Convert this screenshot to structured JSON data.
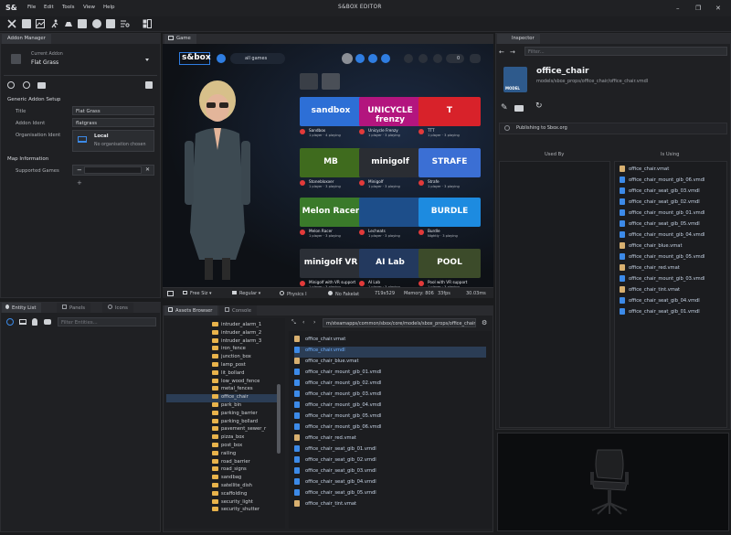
{
  "app": {
    "logo": "S&",
    "title": "S&BOX EDITOR"
  },
  "menu": [
    "File",
    "Edit",
    "Tools",
    "View",
    "Help"
  ],
  "window_controls": {
    "minimize": "–",
    "maximize": "❐",
    "close": "✕"
  },
  "addon_manager": {
    "tab": "Addon Manager",
    "current_label": "Current Addon",
    "current_value": "Flat Grass",
    "setup_title": "Generic Addon Setup",
    "fields": [
      {
        "label": "Title",
        "value": "Flat Grass"
      },
      {
        "label": "Addon Ident",
        "value": "flatgrass"
      }
    ],
    "org_label": "Organisation Ident",
    "org_name": "Local",
    "org_sub": "No organisation chosen",
    "map_info_title": "Map Information",
    "supported_games_label": "Supported Games",
    "add_symbol": "+",
    "remove_symbol": "✕",
    "minus_symbol": "−"
  },
  "game": {
    "tab": "Game",
    "brand": "s&box",
    "all_games": "all games",
    "badge": "0",
    "tiles": [
      {
        "label": "sandbox",
        "title": "Sandbox",
        "meta": "1 player · 4 playing",
        "bg": "#2d6fd6"
      },
      {
        "label": "UNICYCLE frenzy",
        "title": "Unicycle Frenzy",
        "meta": "1 player · 3 playing",
        "bg": "#b3157e"
      },
      {
        "label": "T",
        "title": "TTT",
        "meta": "1 player · 3 playing",
        "bg": "#d8222a"
      },
      {
        "label": "MB",
        "title": "Stonebloxxer",
        "meta": "1 player · 3 playing",
        "bg": "#3f6b1e"
      },
      {
        "label": "minigolf",
        "title": "Minigolf",
        "meta": "1 player · 3 playing",
        "bg": "#2a2d33"
      },
      {
        "label": "STRAFE",
        "title": "Strafe",
        "meta": "1 player · 3 playing",
        "bg": "#3b6fd4"
      },
      {
        "label": "Melon Racer",
        "title": "Melon Racer",
        "meta": "1 player · 3 playing",
        "bg": "#3a7a2a"
      },
      {
        "label": "",
        "title": "Lecheats",
        "meta": "1 player · 3 playing",
        "bg": "#1d4e8a"
      },
      {
        "label": "BURDLE",
        "title": "Burdle",
        "meta": "Nightly · 3 playing",
        "bg": "#1d8be0"
      },
      {
        "label": "minigolf VR",
        "title": "Minigolf with VR support",
        "meta": "1 player · 3 playing",
        "bg": "#2b2f36"
      },
      {
        "label": "AI Lab",
        "title": "AI Lab",
        "meta": "1 player · 3 playing",
        "bg": "#23395e"
      },
      {
        "label": "POOL",
        "title": "Pool with VR support",
        "meta": "1 player · 3 playing",
        "bg": "#3c4b2a"
      }
    ]
  },
  "game_status": {
    "free_size": "Free Siz",
    "regular": "Regular",
    "physics": "Physics I",
    "no_fake_lag": "No Fakelat",
    "resolution": "719x529",
    "memory": "Memory: 806",
    "fps": "33fps",
    "ms": "30.03ms"
  },
  "inspector": {
    "tab": "Inspector",
    "filter_placeholder": "Filter...",
    "asset_name": "office_chair",
    "asset_path": "models/sbox_props/office_chair/office_chair.vmdl",
    "model_badge": "MODEL",
    "publish": "Publishing to Sbox.org",
    "used_by": "Used By",
    "is_using": "Is Using",
    "is_using_items": [
      "office_chair.vmat",
      "office_chair_mount_gib_06.vmdl",
      "office_chair_seat_gib_03.vmdl",
      "office_chair_seat_gib_02.vmdl",
      "office_chair_mount_gib_01.vmdl",
      "office_chair_seat_gib_05.vmdl",
      "office_chair_mount_gib_04.vmdl",
      "office_chair_blue.vmat",
      "office_chair_mount_gib_05.vmdl",
      "office_chair_red.vmat",
      "office_chair_mount_gib_03.vmdl",
      "office_chair_tint.vmat",
      "office_chair_seat_gib_04.vmdl",
      "office_chair_seat_gib_01.vmdl"
    ]
  },
  "entity_list": {
    "tabs": [
      "Entity List",
      "Panels",
      "Icons"
    ],
    "filter_placeholder": "Filter Entities..."
  },
  "assets": {
    "tabs": [
      "Assets Browser",
      "Console"
    ],
    "path": "m/steamapps/common/sbox/core/models/sbox_props/office_chair/",
    "tree": [
      "intruder_alarm_1",
      "intruder_alarm_2",
      "intruder_alarm_3",
      "iron_fence",
      "junction_box",
      "lamp_post",
      "lit_bollard",
      "low_wood_fence",
      "metal_fences",
      "office_chair",
      "park_bin",
      "parking_barrier",
      "parking_bollard",
      "pavement_sewer_r",
      "pizza_box",
      "post_box",
      "railing",
      "road_barrier",
      "road_signs",
      "sandbag",
      "satellite_dish",
      "scaffolding",
      "security_light",
      "security_shutter"
    ],
    "selected_tree_index": 9,
    "files": [
      {
        "name": "office_chair.vmat",
        "kind": "vmat"
      },
      {
        "name": "office_chair.vmdl",
        "kind": "vmdl"
      },
      {
        "name": "office_chair_blue.vmat",
        "kind": "vmat"
      },
      {
        "name": "office_chair_mount_gib_01.vmdl",
        "kind": "vmdl"
      },
      {
        "name": "office_chair_mount_gib_02.vmdl",
        "kind": "vmdl"
      },
      {
        "name": "office_chair_mount_gib_03.vmdl",
        "kind": "vmdl"
      },
      {
        "name": "office_chair_mount_gib_04.vmdl",
        "kind": "vmdl"
      },
      {
        "name": "office_chair_mount_gib_05.vmdl",
        "kind": "vmdl"
      },
      {
        "name": "office_chair_mount_gib_06.vmdl",
        "kind": "vmdl"
      },
      {
        "name": "office_chair_red.vmat",
        "kind": "vmat"
      },
      {
        "name": "office_chair_seat_gib_01.vmdl",
        "kind": "vmdl"
      },
      {
        "name": "office_chair_seat_gib_02.vmdl",
        "kind": "vmdl"
      },
      {
        "name": "office_chair_seat_gib_03.vmdl",
        "kind": "vmdl"
      },
      {
        "name": "office_chair_seat_gib_04.vmdl",
        "kind": "vmdl"
      },
      {
        "name": "office_chair_seat_gib_05.vmdl",
        "kind": "vmdl"
      },
      {
        "name": "office_chair_tint.vmat",
        "kind": "vmat"
      }
    ],
    "selected_file_index": 1
  },
  "colors": {
    "accent": "#2f7de1",
    "folder": "#e8b34b",
    "vmat": "#d8b070",
    "vmdl": "#3c8ae8",
    "selected": "#2b3d55"
  }
}
